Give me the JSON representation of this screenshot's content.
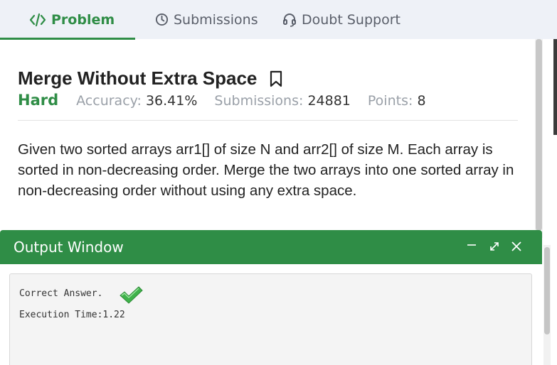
{
  "tabs": [
    {
      "label": "Problem",
      "icon": "code-icon",
      "active": true
    },
    {
      "label": "Submissions",
      "icon": "clock-icon",
      "active": false
    },
    {
      "label": "Doubt Support",
      "icon": "headset-icon",
      "active": false
    }
  ],
  "problem": {
    "title": "Merge Without Extra Space",
    "difficulty": "Hard",
    "accuracy_label": "Accuracy:",
    "accuracy_value": "36.41%",
    "submissions_label": "Submissions:",
    "submissions_value": "24881",
    "points_label": "Points:",
    "points_value": "8",
    "description": "Given two sorted arrays arr1[] of size N and arr2[] of size M. Each array is sorted in non-decreasing order. Merge the two arrays into one sorted array in non-decreasing order without using any extra space."
  },
  "output_window": {
    "title": "Output Window",
    "line1": "Correct Answer.",
    "line2": "Execution Time:1.22"
  },
  "colors": {
    "accent_green": "#2f8d46",
    "tab_bar_bg": "#eef1f7",
    "output_body_bg": "#f4f4f4"
  }
}
